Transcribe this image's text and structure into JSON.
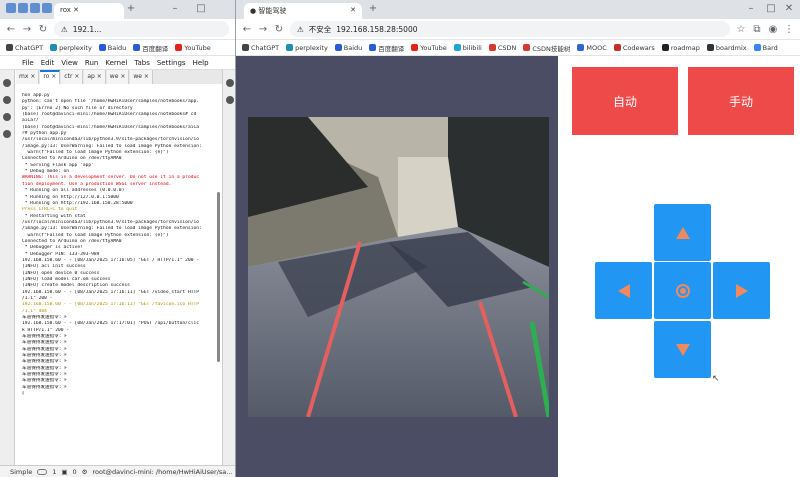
{
  "left_browser": {
    "tab_label": "rox",
    "address": "192.1...",
    "bookmarks": [
      "ChatGPT",
      "perplexity",
      "Baidu",
      "百度翻译",
      "YouTube"
    ]
  },
  "jupyter": {
    "menu": [
      "File",
      "Edit",
      "View",
      "Run",
      "Kernel",
      "Tabs",
      "Settings",
      "Help"
    ],
    "tabs": [
      "mx",
      "ro",
      "ctr",
      "ap",
      "we",
      "we"
    ],
    "terminal_lines": [
      {
        "text": "hon app.py",
        "color": ""
      },
      {
        "text": "python: can't open file '/home/HwHiAiUser/samples/notebooks/app.",
        "color": ""
      },
      {
        "text": "py': [Errno 2] No such file or directory",
        "color": ""
      },
      {
        "text": "(base) root@davinci-mini:/home/HwHiAiUser/samples/notebooks# cd",
        "color": ""
      },
      {
        "text": "aiCar/",
        "color": ""
      },
      {
        "text": "(base) root@davinci-mini:/home/HwHiAiUser/samples/notebooks/aiCa",
        "color": ""
      },
      {
        "text": "r# python app.py",
        "color": ""
      },
      {
        "text": "/usr/local/miniconda3/lib/python3.9/site-packages/torchvision/io",
        "color": ""
      },
      {
        "text": "/image.py:13: UserWarning: Failed to load image Python extension:",
        "color": ""
      },
      {
        "text": "  warn(f\"Failed to load image Python extension: {e}\")",
        "color": ""
      },
      {
        "text": "Connected to Arduino on /dev/ttyAMA0",
        "color": ""
      },
      {
        "text": " * Serving Flask app 'app'",
        "color": ""
      },
      {
        "text": " * Debug mode: on",
        "color": ""
      },
      {
        "text": "WARNING: This is a development server. Do not use it in a produc",
        "color": "red"
      },
      {
        "text": "tion deployment. Use a production WSGI server instead.",
        "color": "red"
      },
      {
        "text": " * Running on all addresses (0.0.0.0)",
        "color": ""
      },
      {
        "text": " * Running on http://127.0.0.1:5000",
        "color": ""
      },
      {
        "text": " * Running on http://192.168.158.28:5000",
        "color": ""
      },
      {
        "text": "Press CTRL+C to quit",
        "color": "yellow"
      },
      {
        "text": " * Restarting with stat",
        "color": ""
      },
      {
        "text": "/usr/local/miniconda3/lib/python3.9/site-packages/torchvision/io",
        "color": ""
      },
      {
        "text": "/image.py:13: UserWarning: Failed to load image Python extension:",
        "color": ""
      },
      {
        "text": "  warn(f\"Failed to load image Python extension: {e}\")",
        "color": ""
      },
      {
        "text": "Connected to Arduino on /dev/ttyAMA0",
        "color": ""
      },
      {
        "text": " * Debugger is active!",
        "color": ""
      },
      {
        "text": " * Debugger PIN: 133-393-989",
        "color": ""
      },
      {
        "text": "192.168.158.60 - - [08/Jan/2025 17:16:05] \"GET / HTTP/1.1\" 200 -",
        "color": ""
      },
      {
        "text": "[INFO] acl init success",
        "color": ""
      },
      {
        "text": "[INFO] open device 0 success",
        "color": ""
      },
      {
        "text": "[INFO] load model car.om success",
        "color": ""
      },
      {
        "text": "[INFO] create model description success",
        "color": ""
      },
      {
        "text": "192.168.158.60 - - [08/Jan/2025 17:16:11] \"GET /video_start HTTP",
        "color": ""
      },
      {
        "text": "/1.1\" 200 -",
        "color": ""
      },
      {
        "text": "192.168.158.60 - - [08/Jan/2025 17:16:11] \"GET /favicon.ico HTTP",
        "color": "yellow"
      },
      {
        "text": "/1.1\" 404 -",
        "color": "yellow"
      },
      {
        "text": "车道保持发送指令: F",
        "color": ""
      },
      {
        "text": "192.168.158.60 - - [08/Jan/2025 17:17:01] \"POST /api/button/clic",
        "color": ""
      },
      {
        "text": "k HTTP/1.1\" 200 -",
        "color": ""
      },
      {
        "text": "车道保持发送指令: F",
        "color": ""
      },
      {
        "text": "车道保持发送指令: F",
        "color": ""
      },
      {
        "text": "车道保持发送指令: F",
        "color": ""
      },
      {
        "text": "车道保持发送指令: F",
        "color": ""
      },
      {
        "text": "车道保持发送指令: F",
        "color": ""
      },
      {
        "text": "车道保持发送指令: F",
        "color": ""
      },
      {
        "text": "车道保持发送指令: F",
        "color": ""
      },
      {
        "text": "车道保持发送指令: F",
        "color": ""
      },
      {
        "text": "车道保持发送指令: F",
        "color": ""
      },
      {
        "text": "▯",
        "color": ""
      }
    ],
    "status": {
      "mode": "Simple",
      "count_a": "1",
      "count_b": "0",
      "path": "root@davinci-mini: /home/HwHiAiUser/sa..."
    }
  },
  "right_browser": {
    "tab_title": "智能驾驶",
    "security": "不安全",
    "url": "192.168.158.28:5000",
    "bookmarks": [
      "ChatGPT",
      "perplexity",
      "Baidu",
      "百度翻译",
      "YouTube",
      "bilibili",
      "CSDN",
      "CSDN技能树",
      "MOOC",
      "Codewars",
      "roadmap",
      "boardmix",
      "Bard"
    ]
  },
  "controls": {
    "auto_label": "自动",
    "manual_label": "手动"
  },
  "colors": {
    "mode_button": "#ef4a4a",
    "dpad": "#2196f3",
    "dpad_icon": "#ef8a5e",
    "video_bg": "#4b4d65"
  }
}
